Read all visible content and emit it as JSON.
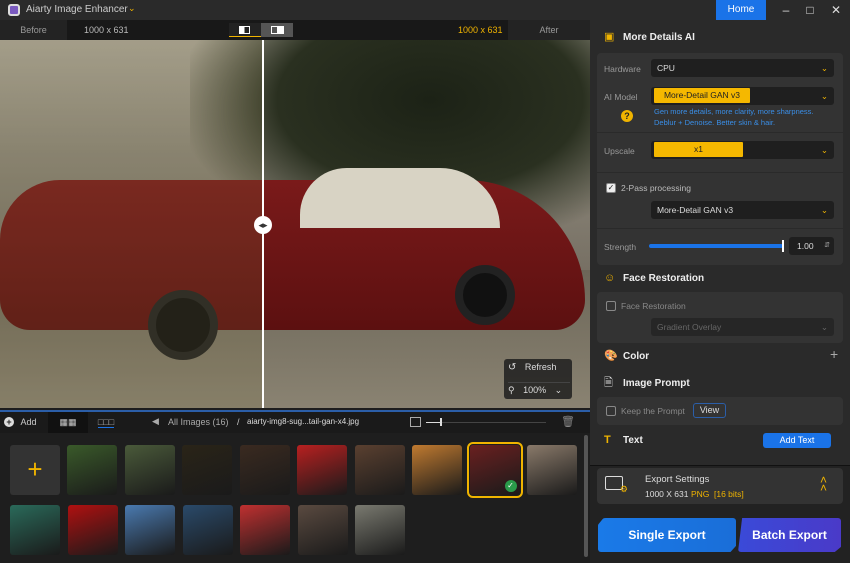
{
  "app": {
    "title": "Aiarty Image Enhancer",
    "home": "Home"
  },
  "compare": {
    "before": "Before",
    "after": "After",
    "before_size": "1000 x 631",
    "after_size": "1000 x 631"
  },
  "viewer": {
    "refresh": "Refresh",
    "zoom": "100%"
  },
  "bottom": {
    "add": "Add",
    "all_images": "All Images (16)",
    "sep": "/",
    "filename": "aiarty-img8-sug...tail-gan-x4.jpg"
  },
  "thumbnails": {
    "row1": [
      "#3a5a2a",
      "#4a5a3a",
      "#2a2418",
      "#3a2a20",
      "#b82020",
      "#5a4030",
      "#c07a30",
      "#6a2020",
      "#8a7a6a"
    ],
    "row2": [
      "#2a6a5a",
      "#b01010",
      "#4a7ab0",
      "#2a4a6a",
      "#c03030",
      "#5a4a40",
      "#7a7a70"
    ],
    "selected_index": 7
  },
  "panel": {
    "more_details": {
      "title": "More Details AI",
      "hardware_label": "Hardware",
      "hardware": "CPU",
      "model_label": "AI Model",
      "model": "More-Detail GAN  v3",
      "model_desc1": "Gen more details, more clarity, more sharpness.",
      "model_desc2": "Deblur + Denoise. Better skin & hair.",
      "help": "?",
      "upscale_label": "Upscale",
      "upscale": "x1",
      "two_pass": "2-Pass processing",
      "two_pass_checked": true,
      "two_pass_model": "More-Detail GAN  v3",
      "strength_label": "Strength",
      "strength": "1.00",
      "strength_fraction": 1.0
    },
    "face": {
      "title": "Face Restoration",
      "checkbox": "Face Restoration",
      "option": "Gradient Overlay"
    },
    "color": {
      "title": "Color"
    },
    "prompt": {
      "title": "Image Prompt",
      "keep": "Keep the Prompt",
      "view": "View"
    },
    "text": {
      "title": "Text",
      "add": "Add Text"
    },
    "export": {
      "title": "Export Settings",
      "size": "1000 X 631",
      "format": "PNG",
      "bits": "[16 bits]",
      "single": "Single Export",
      "batch": "Batch Export"
    }
  }
}
